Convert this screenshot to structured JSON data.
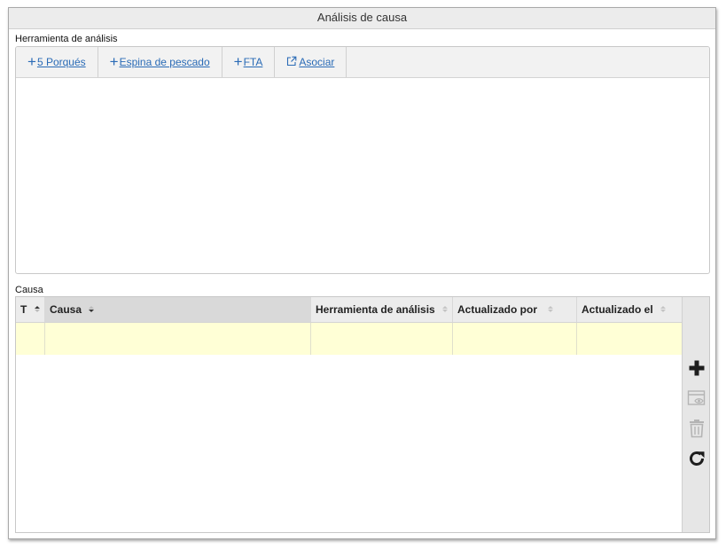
{
  "panel": {
    "title": "Análisis de causa"
  },
  "analysis": {
    "label": "Herramienta de análisis",
    "tools": [
      {
        "label": "5 Porqués",
        "icon": "plus-icon"
      },
      {
        "label": "Espina de pescado",
        "icon": "plus-icon"
      },
      {
        "label": "FTA",
        "icon": "plus-icon"
      },
      {
        "label": "Asociar",
        "icon": "external-link-icon"
      }
    ]
  },
  "cause": {
    "label": "Causa",
    "columns": [
      "T",
      "Causa",
      "Herramienta de análisis",
      "Actualizado por",
      "Actualizado el"
    ],
    "row_color": "#ffffd6",
    "actions": [
      {
        "name": "add",
        "icon": "plus-icon",
        "enabled": true
      },
      {
        "name": "view",
        "icon": "view-icon",
        "enabled": false
      },
      {
        "name": "delete",
        "icon": "trash-icon",
        "enabled": false
      },
      {
        "name": "refresh",
        "icon": "refresh-icon",
        "enabled": true
      }
    ]
  },
  "colors": {
    "link": "#2a6bb6",
    "disabled": "#b4b4b4"
  }
}
